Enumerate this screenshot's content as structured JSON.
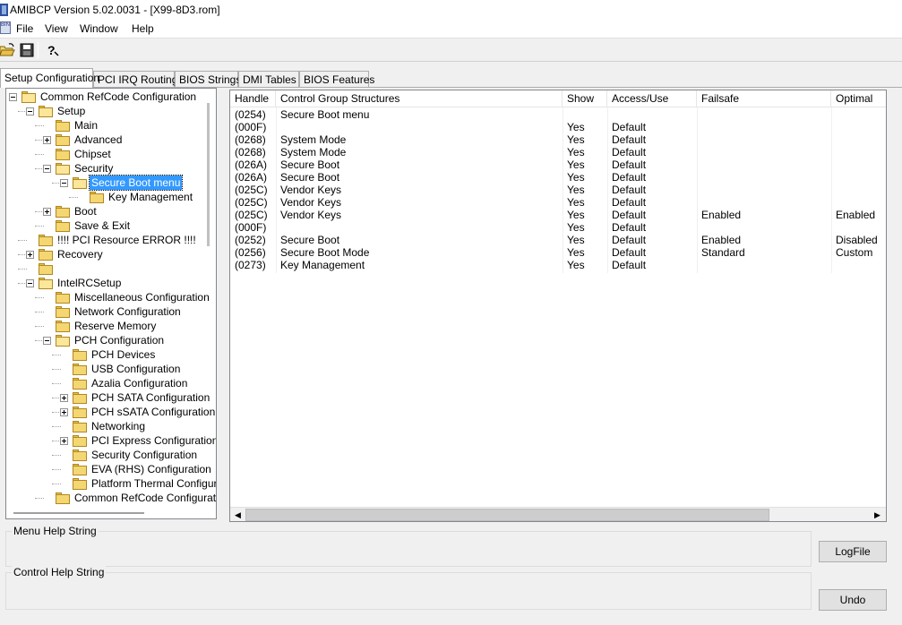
{
  "window": {
    "title": "AMIBCP Version 5.02.0031 - [X99-8D3.rom]"
  },
  "menu": {
    "items": [
      "File",
      "View",
      "Window",
      "Help"
    ]
  },
  "toolbar": {
    "buttons": [
      "open-icon",
      "save-icon",
      "help-icon"
    ]
  },
  "tabs": [
    "Setup Configuration",
    "PCI IRQ Routing",
    "BIOS Strings",
    "DMI Tables",
    "BIOS Features"
  ],
  "tree": {
    "nodes": [
      {
        "label": "Common RefCode Configuration",
        "expander": "minus"
      },
      {
        "label": "Setup",
        "expander": "minus"
      },
      {
        "label": "Main",
        "expander": ""
      },
      {
        "label": "Advanced",
        "expander": "plus"
      },
      {
        "label": "Chipset",
        "expander": ""
      },
      {
        "label": "Security",
        "expander": "minus"
      },
      {
        "label": "Secure Boot menu",
        "expander": "minus",
        "selected": true
      },
      {
        "label": "Key Management",
        "expander": ""
      },
      {
        "label": "Boot",
        "expander": "plus"
      },
      {
        "label": "Save & Exit",
        "expander": ""
      },
      {
        "label": "!!!! PCI Resource ERROR !!!!",
        "expander": ""
      },
      {
        "label": "Recovery",
        "expander": "plus"
      },
      {
        "label": "",
        "expander": ""
      },
      {
        "label": "IntelRCSetup",
        "expander": "minus"
      },
      {
        "label": "Miscellaneous Configuration",
        "expander": ""
      },
      {
        "label": "Network Configuration",
        "expander": ""
      },
      {
        "label": "Reserve Memory",
        "expander": ""
      },
      {
        "label": "PCH Configuration",
        "expander": "minus"
      },
      {
        "label": "PCH Devices",
        "expander": ""
      },
      {
        "label": "USB Configuration",
        "expander": ""
      },
      {
        "label": "Azalia Configuration",
        "expander": ""
      },
      {
        "label": "PCH SATA Configuration",
        "expander": "plus"
      },
      {
        "label": "PCH sSATA Configuration",
        "expander": "plus"
      },
      {
        "label": "Networking",
        "expander": ""
      },
      {
        "label": "PCI Express Configuration",
        "expander": "plus"
      },
      {
        "label": "Security Configuration",
        "expander": ""
      },
      {
        "label": "EVA (RHS) Configuration",
        "expander": ""
      },
      {
        "label": "Platform Thermal Configuration",
        "expander": ""
      },
      {
        "label": "Common RefCode Configuration",
        "expander": ""
      }
    ]
  },
  "grid": {
    "columns": [
      "Handle",
      "Control Group Structures",
      "Show",
      "Access/Use",
      "Failsafe",
      "Optimal"
    ],
    "rows": [
      [
        "(0254)",
        "Secure Boot menu",
        "",
        "",
        "",
        ""
      ],
      [
        "(000F)",
        "",
        "Yes",
        "Default",
        "",
        ""
      ],
      [
        "(0268)",
        "System Mode",
        "Yes",
        "Default",
        "",
        ""
      ],
      [
        "(0268)",
        "System Mode",
        "Yes",
        "Default",
        "",
        ""
      ],
      [
        "(026A)",
        "Secure Boot",
        "Yes",
        "Default",
        "",
        ""
      ],
      [
        "(026A)",
        "Secure Boot",
        "Yes",
        "Default",
        "",
        ""
      ],
      [
        "(025C)",
        "Vendor Keys",
        "Yes",
        "Default",
        "",
        ""
      ],
      [
        "(025C)",
        "Vendor Keys",
        "Yes",
        "Default",
        "",
        ""
      ],
      [
        "(025C)",
        "Vendor Keys",
        "Yes",
        "Default",
        "Enabled",
        "Enabled"
      ],
      [
        "(000F)",
        "",
        "Yes",
        "Default",
        "",
        ""
      ],
      [
        "(0252)",
        "Secure Boot",
        "Yes",
        "Default",
        "Enabled",
        "Disabled"
      ],
      [
        "(0256)",
        "Secure Boot Mode",
        "Yes",
        "Default",
        "Standard",
        "Custom"
      ],
      [
        "(0273)",
        "Key Management",
        "Yes",
        "Default",
        "",
        ""
      ]
    ]
  },
  "bottom": {
    "menu_help_label": "Menu Help String",
    "control_help_label": "Control Help String",
    "logfile_button": "LogFile",
    "undo_button": "Undo"
  }
}
